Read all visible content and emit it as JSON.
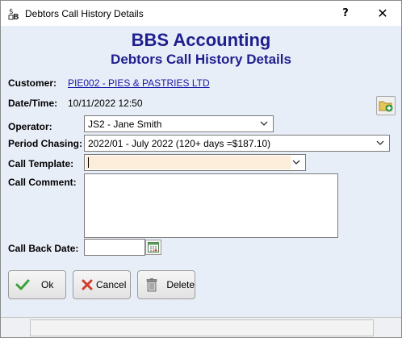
{
  "window": {
    "title": "Debtors Call History Details",
    "help_glyph": "?",
    "close_glyph": "✕"
  },
  "header": {
    "company": "BBS Accounting",
    "subtitle": "Debtors Call History Details"
  },
  "form": {
    "customer_label": "Customer:",
    "customer_value": "PIE002 - PIES & PASTRIES LTD",
    "datetime_label": "Date/Time:",
    "datetime_value": "10/11/2022 12:50",
    "operator_label": "Operator:",
    "operator_value": "JS2 - Jane Smith",
    "period_label": "Period Chasing:",
    "period_value": "2022/01 - July 2022 (120+ days =$187.10)",
    "template_label": "Call Template:",
    "template_value": "",
    "comment_label": "Call Comment:",
    "comment_value": "",
    "callback_label": "Call Back Date:",
    "callback_value": ""
  },
  "buttons": {
    "ok": "Ok",
    "cancel": "Cancel",
    "delete": "Delete"
  },
  "colors": {
    "header_blue": "#1f1f8f",
    "link_blue": "#1a1aa8",
    "template_field_bg": "#fdeedb",
    "window_bg": "#e8eef7"
  },
  "icons": {
    "app": "app-icon",
    "folder_add": "folder-add-icon",
    "calendar": "calendar-icon",
    "ok": "checkmark-icon",
    "cancel": "red-x-icon",
    "delete": "trash-can-icon"
  }
}
